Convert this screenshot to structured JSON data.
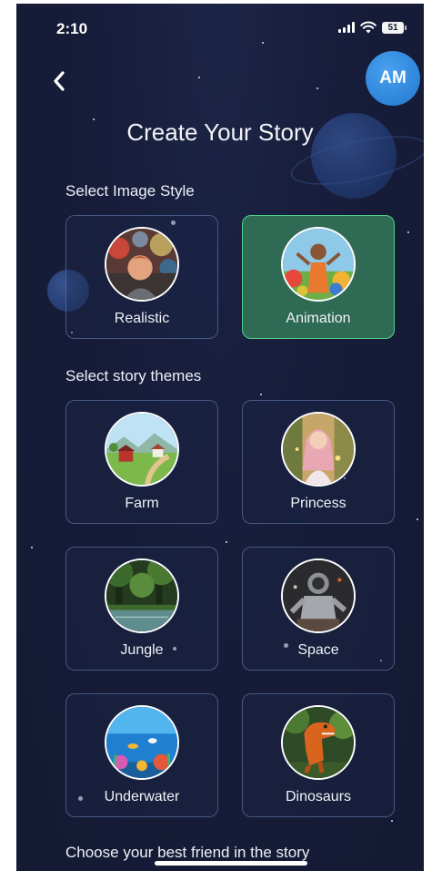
{
  "status_bar": {
    "time": "2:10",
    "battery": "51"
  },
  "header": {
    "title": "Create Your Story",
    "avatar_initials": "AM"
  },
  "image_style": {
    "label": "Select Image Style",
    "options": [
      {
        "label": "Realistic",
        "selected": false
      },
      {
        "label": "Animation",
        "selected": true
      }
    ]
  },
  "themes": {
    "label": "Select story themes",
    "options": [
      {
        "label": "Farm"
      },
      {
        "label": "Princess"
      },
      {
        "label": "Jungle"
      },
      {
        "label": "Space"
      },
      {
        "label": "Underwater"
      },
      {
        "label": "Dinosaurs"
      }
    ]
  },
  "friend_section": {
    "label": "Choose your best friend in the story"
  },
  "colors": {
    "background": "#171d3a",
    "selected_card": "#2f6a55",
    "selected_border": "#4fd08d",
    "avatar": "#2d84d9"
  }
}
